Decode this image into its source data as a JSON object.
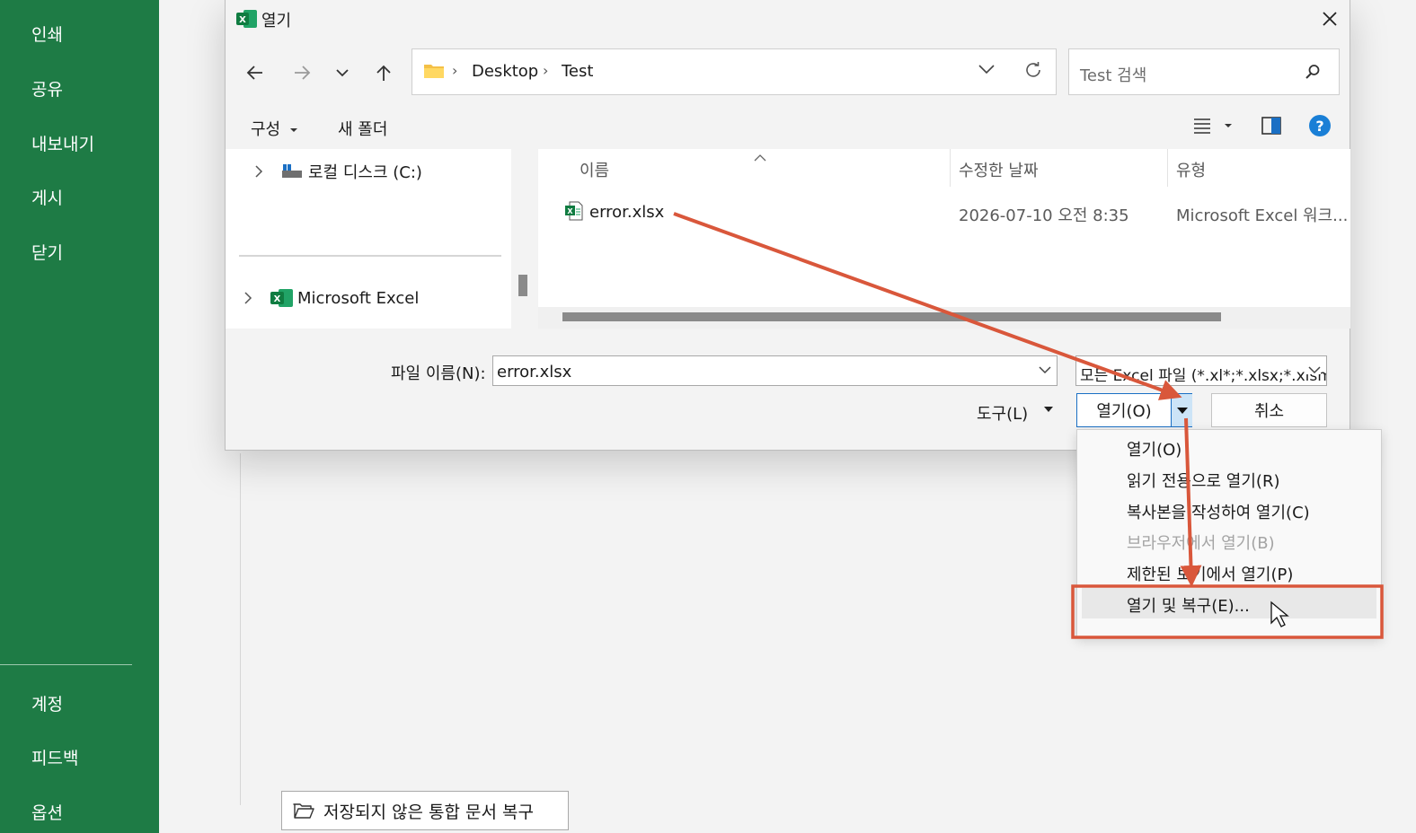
{
  "sidebar": {
    "items_top": [
      "인쇄",
      "공유",
      "내보내기",
      "게시",
      "닫기"
    ],
    "items_bottom": [
      "계정",
      "피드백",
      "옵션"
    ]
  },
  "background": {
    "recover_button": "저장되지 않은 통합 문서 복구"
  },
  "dialog": {
    "title": "열기",
    "breadcrumb": [
      "Desktop",
      "Test"
    ],
    "search_placeholder": "Test 검색",
    "toolbar": {
      "organize": "구성",
      "new_folder": "새 폴더"
    },
    "nav": [
      {
        "label": "로컬 디스크 (C:)",
        "icon": "drive-icon"
      },
      {
        "label": "Microsoft Excel",
        "icon": "excel-icon"
      }
    ],
    "columns": [
      "이름",
      "수정한 날짜",
      "유형"
    ],
    "files": [
      {
        "name": "error.xlsx",
        "modified": "2026-07-10 오전 8:35",
        "type": "Microsoft Excel 워크..."
      }
    ],
    "filename_label": "파일 이름(N):",
    "filename_value": "error.xlsx",
    "filetype_value": "모든 Excel 파일 (*.xl*;*.xlsx;*.xlsm",
    "tools_label": "도구(L)",
    "open_label": "열기(O)",
    "cancel_label": "취소"
  },
  "open_menu": {
    "items": [
      {
        "label": "열기(O)",
        "enabled": true
      },
      {
        "label": "읽기 전용으로 열기(R)",
        "enabled": true
      },
      {
        "label": "복사본을 작성하여 열기(C)",
        "enabled": true
      },
      {
        "label": "브라우저에서 열기(B)",
        "enabled": false
      },
      {
        "label": "제한된 보기에서 열기(P)",
        "enabled": true
      },
      {
        "label": "열기 및 복구(E)...",
        "enabled": true,
        "highlighted": true
      }
    ]
  },
  "colors": {
    "excel_green": "#1e7b45",
    "accent_blue": "#1a6fc4",
    "annotation_red": "#d9573b"
  }
}
